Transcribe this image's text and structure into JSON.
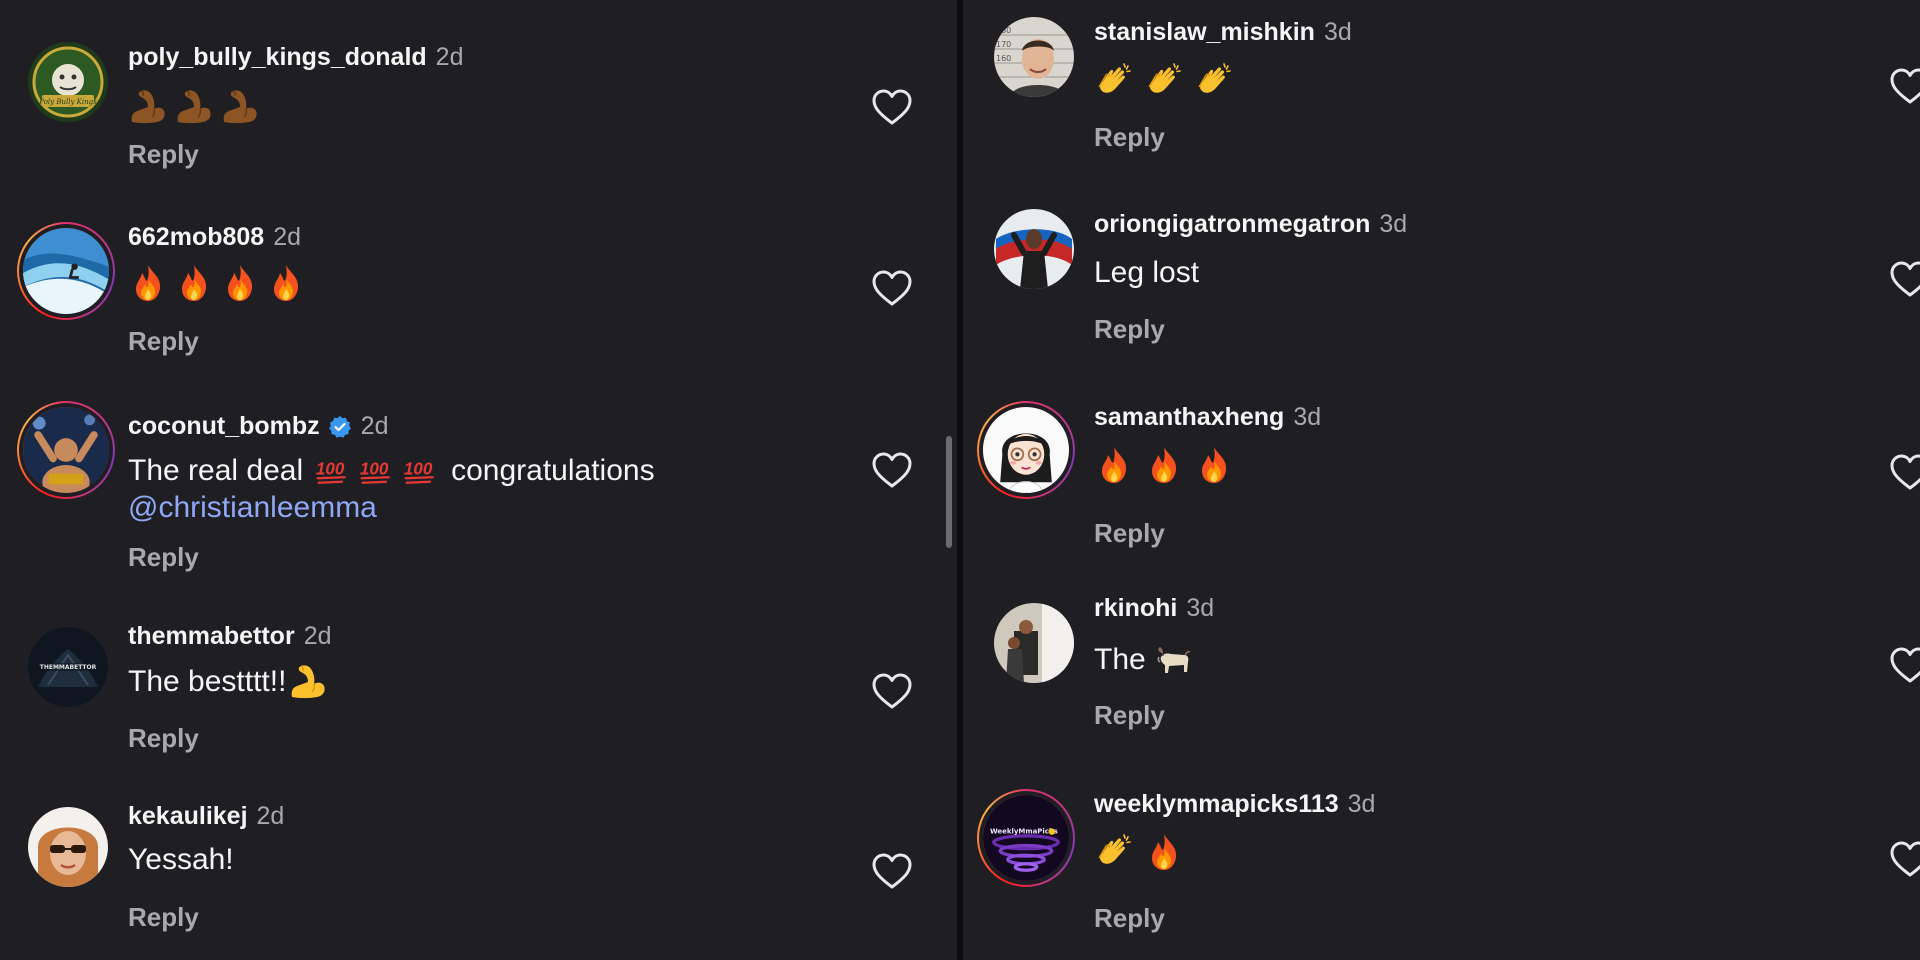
{
  "left": [
    {
      "username": "poly_bully_kings_donald",
      "time": "2d",
      "emojis": [
        "muscle-dark",
        "muscle-dark",
        "muscle-dark"
      ],
      "reply": "Reply"
    },
    {
      "username": "662mob808",
      "time": "2d",
      "emojis": [
        "fire",
        "fire",
        "fire",
        "fire"
      ],
      "reply": "Reply"
    },
    {
      "username": "coconut_bombz",
      "time": "2d",
      "text_a": "The real deal",
      "text_b": "congratulations",
      "mention": "@christianleemma",
      "reply": "Reply"
    },
    {
      "username": "themmabettor",
      "time": "2d",
      "text": "The bestttt!!",
      "reply": "Reply"
    },
    {
      "username": "kekaulikej",
      "time": "2d",
      "text": "Yessah!",
      "reply": "Reply"
    }
  ],
  "right": [
    {
      "username": "stanislaw_mishkin",
      "time": "3d",
      "emojis": [
        "clap",
        "clap",
        "clap"
      ],
      "reply": "Reply"
    },
    {
      "username": "oriongigatronmegatron",
      "time": "3d",
      "text": "Leg lost",
      "reply": "Reply"
    },
    {
      "username": "samanthaxheng",
      "time": "3d",
      "emojis": [
        "fire",
        "fire",
        "fire"
      ],
      "reply": "Reply"
    },
    {
      "username": "rkinohi",
      "time": "3d",
      "text": "The",
      "reply": "Reply"
    },
    {
      "username": "weeklymmapicks113",
      "time": "3d",
      "emojis": [
        "clap",
        "fire"
      ],
      "reply": "Reply"
    }
  ],
  "avatar_images": {
    "poly_bully_kings_donald": "Poly Bully Kings",
    "themmabettor": "THEMMABETTOR",
    "weeklymmapicks113": "WeeklyMmaPicks"
  },
  "avatar_chart_ticks": [
    "180",
    "170",
    "160"
  ],
  "icons": {
    "like": "heart-outline-icon",
    "verified": "verified-badge-icon"
  },
  "colors": {
    "background": "#1f1f23",
    "mention": "#8fa8f5",
    "secondary_text": "#a8a8ad",
    "verified": "#3897f0"
  }
}
